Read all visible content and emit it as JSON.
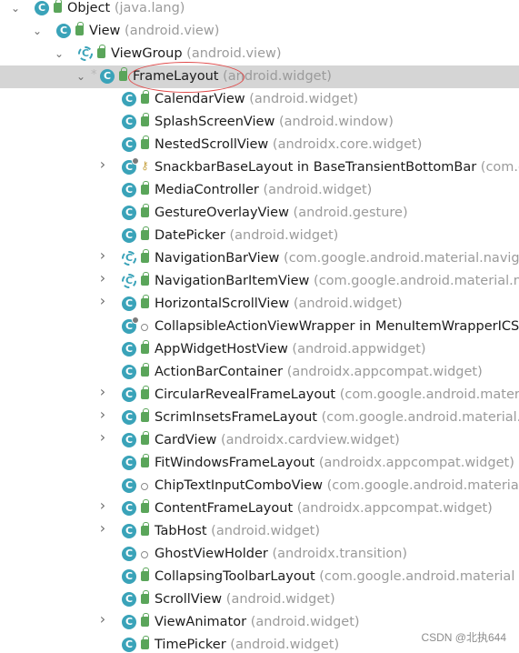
{
  "tree": [
    {
      "name": "Object",
      "pkg": "(java.lang)",
      "depth": 0,
      "arrow": "down",
      "icon": "class",
      "mod": "public"
    },
    {
      "name": "View",
      "pkg": "(android.view)",
      "depth": 1,
      "arrow": "down",
      "icon": "class",
      "mod": "public"
    },
    {
      "name": "ViewGroup",
      "pkg": "(android.view)",
      "depth": 2,
      "arrow": "down",
      "icon": "abstract-class",
      "mod": "public"
    },
    {
      "name": "FrameLayout",
      "pkg": "(android.widget)",
      "depth": 3,
      "arrow": "down",
      "icon": "class",
      "mod": "public",
      "selected": true,
      "star": true
    },
    {
      "name": "CalendarView",
      "pkg": "(android.widget)",
      "depth": 4,
      "arrow": "none",
      "icon": "class",
      "mod": "public"
    },
    {
      "name": "SplashScreenView",
      "pkg": "(android.window)",
      "depth": 4,
      "arrow": "none",
      "icon": "class",
      "mod": "public"
    },
    {
      "name": "NestedScrollView",
      "pkg": "(androidx.core.widget)",
      "depth": 4,
      "arrow": "none",
      "icon": "class",
      "mod": "public"
    },
    {
      "name": "SnackbarBaseLayout in BaseTransientBottomBar",
      "pkg": "(com.g",
      "depth": 4,
      "arrow": "right",
      "icon": "inner-class",
      "mod": "protected"
    },
    {
      "name": "MediaController",
      "pkg": "(android.widget)",
      "depth": 4,
      "arrow": "none",
      "icon": "class",
      "mod": "public"
    },
    {
      "name": "GestureOverlayView",
      "pkg": "(android.gesture)",
      "depth": 4,
      "arrow": "none",
      "icon": "class",
      "mod": "public"
    },
    {
      "name": "DatePicker",
      "pkg": "(android.widget)",
      "depth": 4,
      "arrow": "none",
      "icon": "class",
      "mod": "public"
    },
    {
      "name": "NavigationBarView",
      "pkg": "(com.google.android.material.naviga",
      "depth": 4,
      "arrow": "right",
      "icon": "abstract-class",
      "mod": "public"
    },
    {
      "name": "NavigationBarItemView",
      "pkg": "(com.google.android.material.na",
      "depth": 4,
      "arrow": "right",
      "icon": "abstract-class",
      "mod": "public"
    },
    {
      "name": "HorizontalScrollView",
      "pkg": "(android.widget)",
      "depth": 4,
      "arrow": "right",
      "icon": "class",
      "mod": "public"
    },
    {
      "name": "CollapsibleActionViewWrapper in MenuItemWrapperICS",
      "pkg": "",
      "depth": 4,
      "arrow": "none",
      "icon": "inner-class",
      "mod": "package"
    },
    {
      "name": "AppWidgetHostView",
      "pkg": "(android.appwidget)",
      "depth": 4,
      "arrow": "none",
      "icon": "class",
      "mod": "public"
    },
    {
      "name": "ActionBarContainer",
      "pkg": "(androidx.appcompat.widget)",
      "depth": 4,
      "arrow": "none",
      "icon": "class",
      "mod": "public"
    },
    {
      "name": "CircularRevealFrameLayout",
      "pkg": "(com.google.android.materi",
      "depth": 4,
      "arrow": "right",
      "icon": "class",
      "mod": "public"
    },
    {
      "name": "ScrimInsetsFrameLayout",
      "pkg": "(com.google.android.material.i",
      "depth": 4,
      "arrow": "right",
      "icon": "class",
      "mod": "public"
    },
    {
      "name": "CardView",
      "pkg": "(androidx.cardview.widget)",
      "depth": 4,
      "arrow": "right",
      "icon": "class",
      "mod": "public"
    },
    {
      "name": "FitWindowsFrameLayout",
      "pkg": "(androidx.appcompat.widget)",
      "depth": 4,
      "arrow": "none",
      "icon": "class",
      "mod": "public"
    },
    {
      "name": "ChipTextInputComboView",
      "pkg": "(com.google.android.materia",
      "depth": 4,
      "arrow": "none",
      "icon": "class",
      "mod": "package"
    },
    {
      "name": "ContentFrameLayout",
      "pkg": "(androidx.appcompat.widget)",
      "depth": 4,
      "arrow": "right",
      "icon": "class",
      "mod": "public"
    },
    {
      "name": "TabHost",
      "pkg": "(android.widget)",
      "depth": 4,
      "arrow": "right",
      "icon": "class",
      "mod": "public"
    },
    {
      "name": "GhostViewHolder",
      "pkg": "(androidx.transition)",
      "depth": 4,
      "arrow": "none",
      "icon": "class",
      "mod": "package"
    },
    {
      "name": "CollapsingToolbarLayout",
      "pkg": "(com.google.android.material",
      "depth": 4,
      "arrow": "none",
      "icon": "class",
      "mod": "public"
    },
    {
      "name": "ScrollView",
      "pkg": "(android.widget)",
      "depth": 4,
      "arrow": "none",
      "icon": "class",
      "mod": "public"
    },
    {
      "name": "ViewAnimator",
      "pkg": "(android.widget)",
      "depth": 4,
      "arrow": "right",
      "icon": "class",
      "mod": "public"
    },
    {
      "name": "TimePicker",
      "pkg": "(android.widget)",
      "depth": 4,
      "arrow": "none",
      "icon": "class",
      "mod": "public"
    }
  ],
  "icon_letter": "C",
  "colors": {
    "selection": "#d5d5d5",
    "class_icon": "#3aa3b9",
    "package_text": "#9b9b9b",
    "highlight": "#e04a4a"
  },
  "watermark": "CSDN @北执644"
}
